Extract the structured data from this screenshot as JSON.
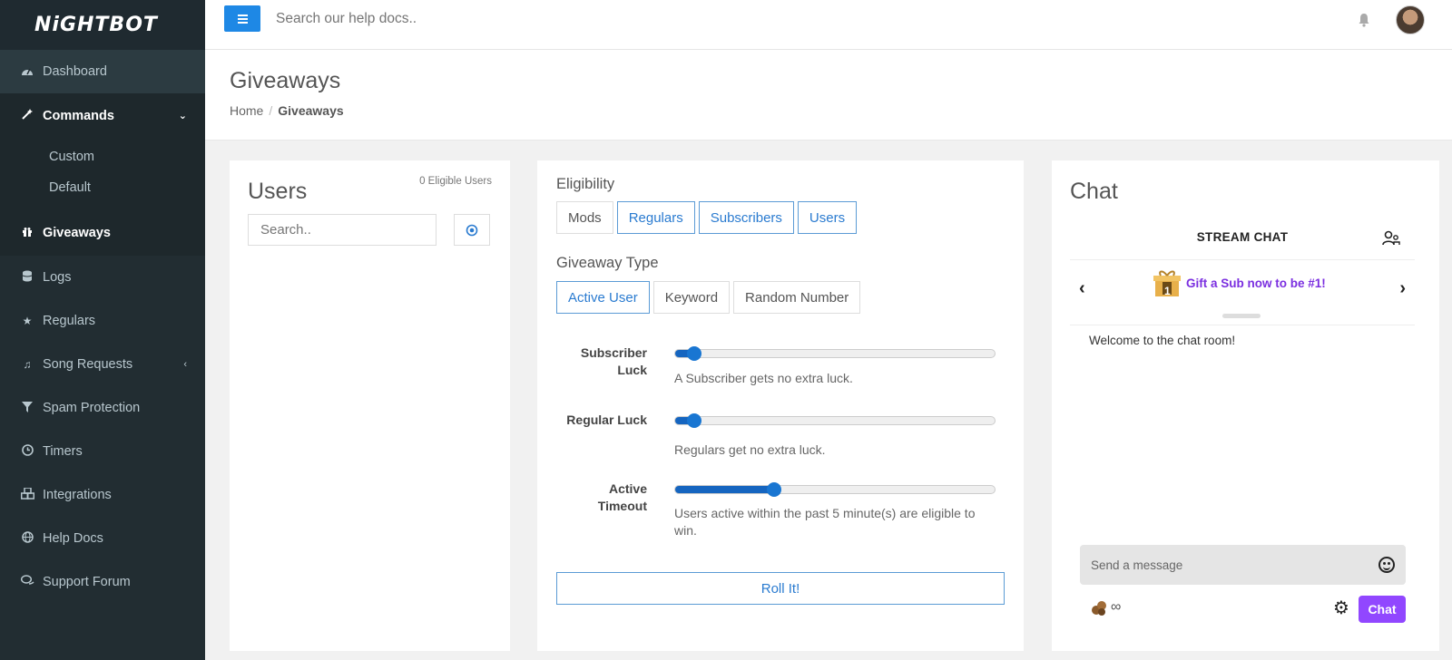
{
  "app": {
    "logo": "NiGHTBOT"
  },
  "topbar": {
    "search_placeholder": "Search our help docs.."
  },
  "sidebar": {
    "items": [
      {
        "label": "Dashboard",
        "icon": "dashboard-icon"
      },
      {
        "label": "Commands",
        "icon": "wand-icon",
        "expanded": true,
        "children": [
          {
            "label": "Custom"
          },
          {
            "label": "Default"
          }
        ]
      },
      {
        "label": "Giveaways",
        "icon": "gift-icon",
        "active": true
      },
      {
        "label": "Logs",
        "icon": "database-icon"
      },
      {
        "label": "Regulars",
        "icon": "star-icon"
      },
      {
        "label": "Song Requests",
        "icon": "music-icon"
      },
      {
        "label": "Spam Protection",
        "icon": "filter-icon"
      },
      {
        "label": "Timers",
        "icon": "clock-icon"
      },
      {
        "label": "Integrations",
        "icon": "cubes-icon"
      },
      {
        "label": "Help Docs",
        "icon": "globe-icon"
      },
      {
        "label": "Support Forum",
        "icon": "comments-icon"
      }
    ]
  },
  "header": {
    "title": "Giveaways",
    "breadcrumb": {
      "home": "Home",
      "sep": "/",
      "current": "Giveaways"
    }
  },
  "users_panel": {
    "title": "Users",
    "eligible_count": "0 Eligible Users",
    "search_placeholder": "Search.."
  },
  "eligibility": {
    "label": "Eligibility",
    "options": [
      "Mods",
      "Regulars",
      "Subscribers",
      "Users"
    ],
    "selected": [
      "Regulars",
      "Subscribers",
      "Users"
    ],
    "type_label": "Giveaway Type",
    "types": [
      "Active User",
      "Keyword",
      "Random Number"
    ],
    "type_selected": "Active User",
    "sliders": [
      {
        "label_1": "Subscriber",
        "label_2": "Luck",
        "value": 0.06,
        "help": "A Subscriber gets no extra luck."
      },
      {
        "label_1": "Regular Luck",
        "label_2": "",
        "value": 0.06,
        "help": "Regulars get no extra luck."
      },
      {
        "label_1": "Active",
        "label_2": "Timeout",
        "value": 0.31,
        "help": "Users active within the past 5 minute(s) are eligible to win."
      }
    ],
    "roll_label": "Roll It!"
  },
  "chat": {
    "title": "Chat",
    "stream_chat": "STREAM CHAT",
    "gift_text": "Gift a Sub now to be #1!",
    "gift_badge": "1",
    "prev": "‹",
    "next": "›",
    "welcome": "Welcome to the chat room!",
    "message_placeholder": "Send a message",
    "infinity": "∞",
    "chat_button": "Chat"
  },
  "colors": {
    "sidebar_bg": "#222d32",
    "accent": "#1e88e5",
    "twitch_purple": "#9147ff"
  }
}
